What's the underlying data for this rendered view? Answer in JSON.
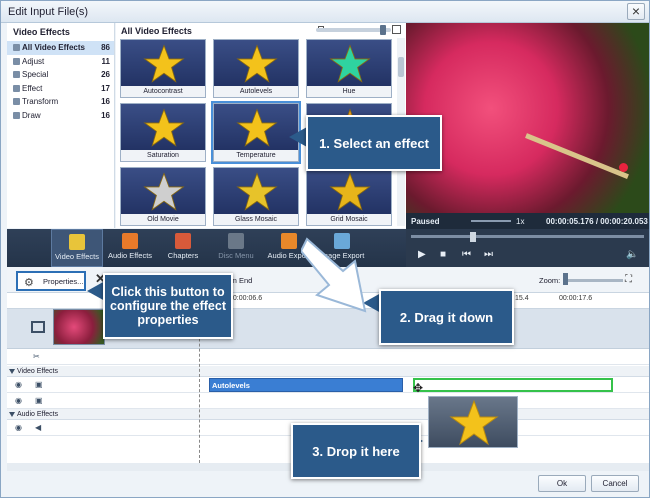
{
  "window": {
    "title": "Edit Input File(s)",
    "close_glyph": "×"
  },
  "categories": {
    "header": "Video Effects",
    "items": [
      {
        "label": "All Video Effects",
        "count": "86",
        "selected": true
      },
      {
        "label": "Adjust",
        "count": "11"
      },
      {
        "label": "Special",
        "count": "26"
      },
      {
        "label": "Effect",
        "count": "17"
      },
      {
        "label": "Transform",
        "count": "16"
      },
      {
        "label": "Draw",
        "count": "16"
      }
    ]
  },
  "gallery": {
    "header": "All Video Effects",
    "tiles": [
      {
        "label": "Autocontrast",
        "star_color": "#f3c21b"
      },
      {
        "label": "Autolevels",
        "star_color": "#f3c21b"
      },
      {
        "label": "Hue",
        "star_color": "#2fd3a0"
      },
      {
        "label": "Saturation",
        "star_color": "#f3c21b"
      },
      {
        "label": "Temperature",
        "star_color": "#f3c21b",
        "selected": true
      },
      {
        "label": "",
        "star_color": "#f0a020"
      },
      {
        "label": "Old Movie",
        "star_color": "#cfcfcf"
      },
      {
        "label": "Glass Mosaic",
        "star_color": "#e7c32a"
      },
      {
        "label": "Grid Mosaic",
        "star_color": "#e7b51a"
      }
    ]
  },
  "preview": {
    "status": "Paused",
    "speed": "1x",
    "timecode": "00:00:05.176 / 00:00:20.053"
  },
  "transport": {
    "play": "▶",
    "stop": "■",
    "prev": "⏮",
    "next": "⏭",
    "speaker": "🔈"
  },
  "toolbar": {
    "items": [
      {
        "label": "Video Effects",
        "active": true,
        "color": "#e8c43a"
      },
      {
        "label": "Audio Effects",
        "color": "#e87a2a"
      },
      {
        "label": "Chapters",
        "color": "#d85a3a"
      },
      {
        "label": "Disc Menu",
        "dim": true,
        "color": "#6a7888"
      },
      {
        "label": "Audio Export",
        "color": "#e8882a"
      },
      {
        "label": "Image Export",
        "color": "#6aa8d8"
      }
    ]
  },
  "timeline": {
    "properties_label": "Properties...",
    "delete_glyph": "✕",
    "trim_end_label": "im End",
    "zoom_label": "Zoom:",
    "ruler": [
      "00:00:06.6",
      "15.4",
      "00:00:17.6"
    ],
    "video_effects_header": "Video Effects",
    "audio_effects_header": "Audio Effects",
    "effect_bar_label": "Autolevels"
  },
  "callouts": {
    "step1": "1. Select an effect",
    "step2": "2. Drag it down",
    "step3": "3. Drop it here",
    "properties": "Click this button to configure the effect properties"
  },
  "footer": {
    "ok": "Ok",
    "cancel": "Cancel"
  }
}
